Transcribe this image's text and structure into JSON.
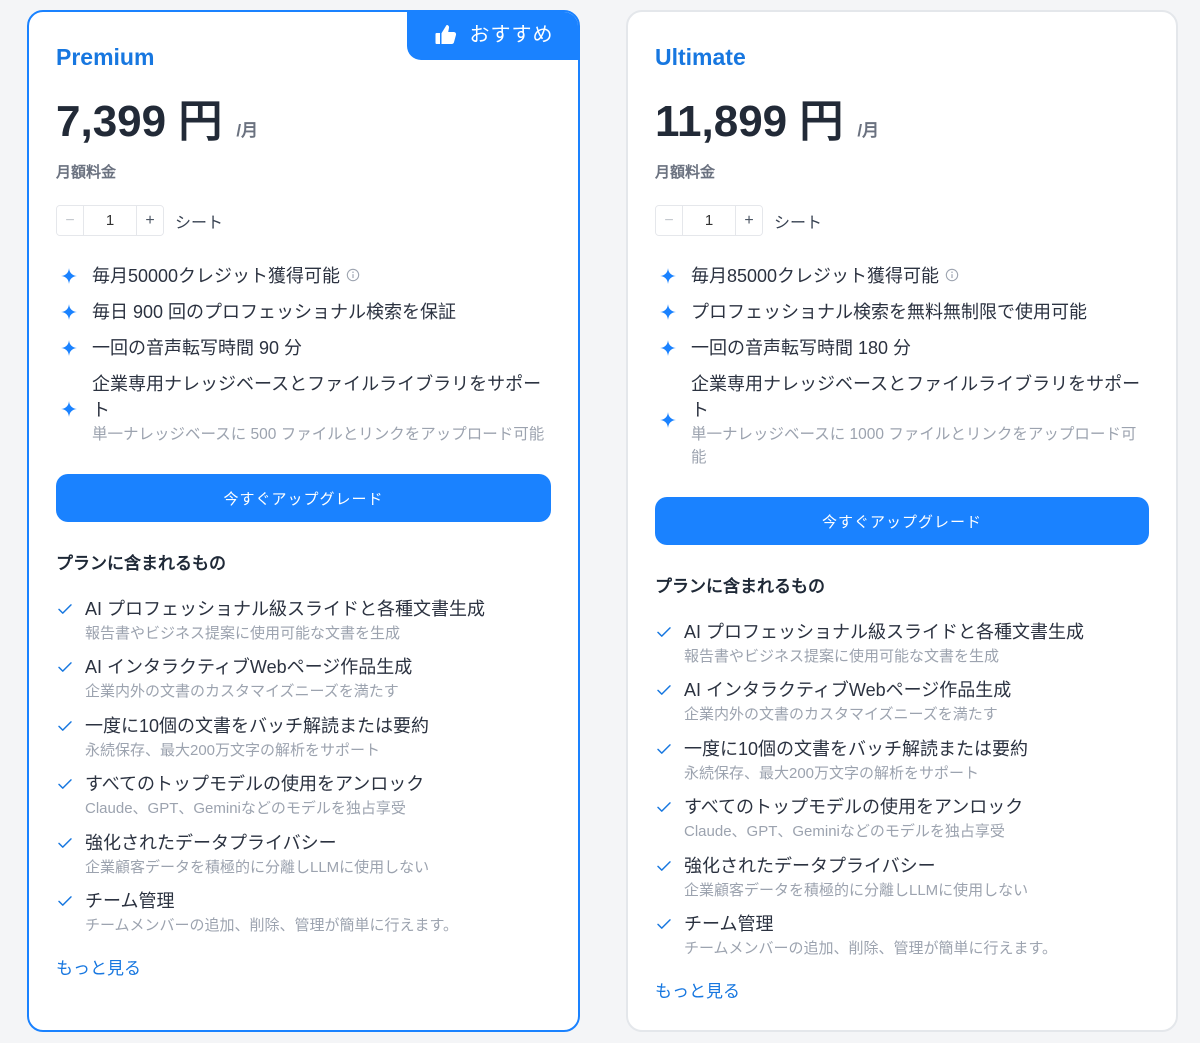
{
  "colors": {
    "background": "#f4f5f7",
    "accent": "#1a82ff",
    "link_blue": "#1777e0",
    "recommended_border": "#1a82ff",
    "default_border": "#e4e7eb",
    "text_primary": "#222a37",
    "text_muted": "#9ca3af"
  },
  "icons": {
    "badge": "thumbs-up-icon",
    "highlight": "sparkle-icon",
    "info": "info-icon",
    "included": "check-icon"
  },
  "plans": [
    {
      "name": "Premium",
      "recommended": true,
      "badge": {
        "label": "おすすめ"
      },
      "price": "7,399 円",
      "price_unit": "/月",
      "price_note": "月額料金",
      "seats": {
        "minus": "−",
        "value": "1",
        "plus": "+",
        "label": "シート"
      },
      "highlights": [
        {
          "text": "毎月50000クレジット獲得可能",
          "has_info": true
        },
        {
          "text": "毎日 900 回のプロフェッショナル検索を保証"
        },
        {
          "text": "一回の音声転写時間 90 分"
        },
        {
          "text": "企業専用ナレッジベースとファイルライブラリをサポート",
          "sub": "単一ナレッジベースに 500 ファイルとリンクをアップロード可能"
        }
      ],
      "cta_label": "今すぐアップグレード",
      "included_heading": "プランに含まれるもの",
      "included": [
        {
          "title": "AI プロフェッショナル級スライドと各種文書生成",
          "sub": "報告書やビジネス提案に使用可能な文書を生成"
        },
        {
          "title": "AI インタラクティブWebページ作品生成",
          "sub": "企業内外の文書のカスタマイズニーズを満たす"
        },
        {
          "title": "一度に10個の文書をバッチ解読または要約",
          "sub": "永続保存、最大200万文字の解析をサポート"
        },
        {
          "title": "すべてのトップモデルの使用をアンロック",
          "sub": "Claude、GPT、Geminiなどのモデルを独占享受"
        },
        {
          "title": "強化されたデータプライバシー",
          "sub": "企業顧客データを積極的に分離しLLMに使用しない"
        },
        {
          "title": "チーム管理",
          "sub": "チームメンバーの追加、削除、管理が簡単に行えます。"
        }
      ],
      "more_link": "もっと見る"
    },
    {
      "name": "Ultimate",
      "recommended": false,
      "price": "11,899 円",
      "price_unit": "/月",
      "price_note": "月額料金",
      "seats": {
        "minus": "−",
        "value": "1",
        "plus": "+",
        "label": "シート"
      },
      "highlights": [
        {
          "text": "毎月85000クレジット獲得可能",
          "has_info": true
        },
        {
          "text": "プロフェッショナル検索を無料無制限で使用可能"
        },
        {
          "text": "一回の音声転写時間 180 分"
        },
        {
          "text": "企業専用ナレッジベースとファイルライブラリをサポート",
          "sub": "単一ナレッジベースに 1000 ファイルとリンクをアップロード可能"
        }
      ],
      "cta_label": "今すぐアップグレード",
      "included_heading": "プランに含まれるもの",
      "included": [
        {
          "title": "AI プロフェッショナル級スライドと各種文書生成",
          "sub": "報告書やビジネス提案に使用可能な文書を生成"
        },
        {
          "title": "AI インタラクティブWebページ作品生成",
          "sub": "企業内外の文書のカスタマイズニーズを満たす"
        },
        {
          "title": "一度に10個の文書をバッチ解読または要約",
          "sub": "永続保存、最大200万文字の解析をサポート"
        },
        {
          "title": "すべてのトップモデルの使用をアンロック",
          "sub": "Claude、GPT、Geminiなどのモデルを独占享受"
        },
        {
          "title": "強化されたデータプライバシー",
          "sub": "企業顧客データを積極的に分離しLLMに使用しない"
        },
        {
          "title": "チーム管理",
          "sub": "チームメンバーの追加、削除、管理が簡単に行えます。"
        }
      ],
      "more_link": "もっと見る"
    }
  ]
}
